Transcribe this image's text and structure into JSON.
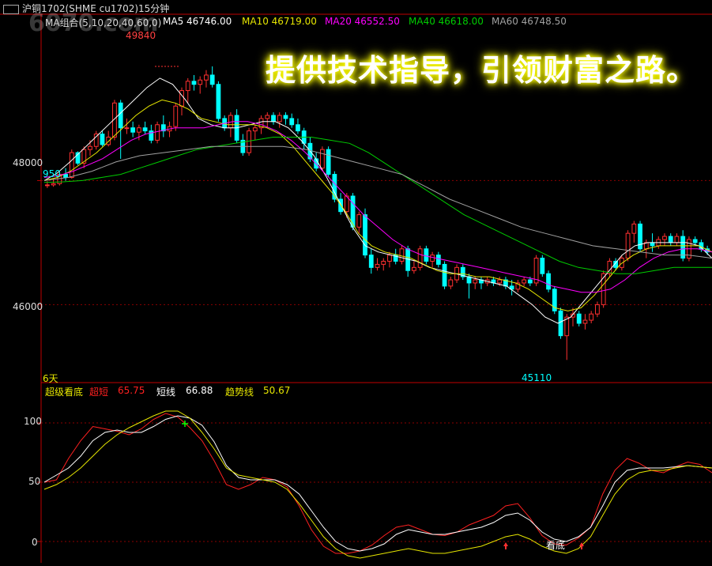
{
  "title": "沪铜1702(SHME  cu1702)15分钟",
  "watermark": "6070.com",
  "slogan": "提供技术指导，引领财富之路。",
  "ma_header": [
    {
      "label": "MA组合(5,10,20,40,60,0)",
      "color": "#d9d9d9"
    },
    {
      "label": "MA5 46746.00",
      "color": "#ffffff"
    },
    {
      "label": "MA10 46719.00",
      "color": "#e6e600"
    },
    {
      "label": "MA20 46552.50",
      "color": "#ff00ff"
    },
    {
      "label": "MA40 46618.00",
      "color": "#00cc00"
    },
    {
      "label": "MA60 46748.50",
      "color": "#a0a0a0"
    }
  ],
  "indicator_header": [
    {
      "label": "超级看底",
      "color": "#e6e600"
    },
    {
      "label": "超短",
      "color": "#ff2020"
    },
    {
      "label": "65.75",
      "color": "#ff2020"
    },
    {
      "label": "短线",
      "color": "#ffffff"
    },
    {
      "label": "66.88",
      "color": "#ffffff"
    },
    {
      "label": "趋势线",
      "color": "#e6e600"
    },
    {
      "label": "50.67",
      "color": "#e6e600"
    }
  ],
  "annotations": {
    "high": "49840",
    "low": "45110",
    "left_price": "950",
    "days": "6天",
    "bottom_signal": "看底"
  },
  "colors": {
    "up": "#ff3030",
    "down": "#00ffff",
    "grid": "#8b0000",
    "axis": "#c00000"
  },
  "chart_data": [
    {
      "type": "candlestick",
      "title": "沪铜1702 15分钟",
      "y_ticks": [
        46000,
        48000
      ],
      "ylim": [
        44770,
        50400
      ],
      "grid": true,
      "candles": [
        [
          47920,
          47990,
          47880,
          47930
        ],
        [
          47930,
          48030,
          47900,
          47950
        ],
        [
          47950,
          48150,
          47920,
          48100
        ],
        [
          48100,
          48200,
          48000,
          48050
        ],
        [
          48050,
          48500,
          48030,
          48450
        ],
        [
          48450,
          48470,
          48250,
          48280
        ],
        [
          48280,
          48550,
          48200,
          48500
        ],
        [
          48500,
          48650,
          48400,
          48550
        ],
        [
          48550,
          48800,
          48500,
          48750
        ],
        [
          48750,
          48800,
          48550,
          48580
        ],
        [
          48580,
          48800,
          48550,
          48700
        ],
        [
          48700,
          49300,
          48650,
          49250
        ],
        [
          49250,
          49300,
          48350,
          48850
        ],
        [
          48850,
          49000,
          48750,
          48850
        ],
        [
          48850,
          48950,
          48700,
          48780
        ],
        [
          48780,
          48900,
          48650,
          48850
        ],
        [
          48850,
          48950,
          48750,
          48800
        ],
        [
          48800,
          48900,
          48600,
          48650
        ],
        [
          48650,
          48950,
          48600,
          48900
        ],
        [
          48900,
          49050,
          48700,
          48800
        ],
        [
          48800,
          48950,
          48700,
          48870
        ],
        [
          48870,
          49250,
          48800,
          49200
        ],
        [
          49200,
          49500,
          49050,
          49450
        ],
        [
          49450,
          49650,
          49250,
          49600
        ],
        [
          49600,
          49700,
          49450,
          49550
        ],
        [
          49550,
          49680,
          49400,
          49620
        ],
        [
          49620,
          49780,
          49500,
          49700
        ],
        [
          49700,
          49840,
          49500,
          49550
        ],
        [
          49550,
          49600,
          48950,
          49000
        ],
        [
          49000,
          49050,
          48800,
          48850
        ],
        [
          48850,
          49100,
          48700,
          49050
        ],
        [
          49050,
          49150,
          48600,
          48650
        ],
        [
          48650,
          48750,
          48400,
          48450
        ],
        [
          48450,
          48850,
          48400,
          48800
        ],
        [
          48800,
          48900,
          48650,
          48850
        ],
        [
          48850,
          49050,
          48750,
          49000
        ],
        [
          49000,
          49100,
          48850,
          49050
        ],
        [
          49050,
          49100,
          48900,
          48950
        ],
        [
          48950,
          49100,
          48850,
          49050
        ],
        [
          49050,
          49100,
          48900,
          49000
        ],
        [
          49000,
          49080,
          48850,
          48900
        ],
        [
          48900,
          49000,
          48750,
          48800
        ],
        [
          48800,
          48850,
          48500,
          48600
        ],
        [
          48600,
          48700,
          48300,
          48350
        ],
        [
          48350,
          48450,
          48150,
          48200
        ],
        [
          48200,
          48550,
          48150,
          48500
        ],
        [
          48500,
          48550,
          48050,
          48100
        ],
        [
          48100,
          48150,
          47650,
          47700
        ],
        [
          47700,
          47800,
          47450,
          47500
        ],
        [
          47500,
          47800,
          47400,
          47750
        ],
        [
          47750,
          47800,
          47200,
          47250
        ],
        [
          47250,
          47500,
          47150,
          47450
        ],
        [
          47450,
          47550,
          46750,
          46800
        ],
        [
          46800,
          46900,
          46500,
          46600
        ],
        [
          46600,
          46750,
          46550,
          46650
        ],
        [
          46650,
          46750,
          46550,
          46700
        ],
        [
          46700,
          46850,
          46600,
          46800
        ],
        [
          46800,
          46900,
          46650,
          46700
        ],
        [
          46700,
          46950,
          46650,
          46900
        ],
        [
          46900,
          46950,
          46450,
          46550
        ],
        [
          46550,
          46700,
          46500,
          46600
        ],
        [
          46600,
          46950,
          46550,
          46900
        ],
        [
          46900,
          46950,
          46650,
          46700
        ],
        [
          46700,
          46850,
          46600,
          46800
        ],
        [
          46800,
          46850,
          46600,
          46650
        ],
        [
          46650,
          46700,
          46250,
          46300
        ],
        [
          46300,
          46450,
          46250,
          46400
        ],
        [
          46400,
          46650,
          46350,
          46600
        ],
        [
          46600,
          46650,
          46400,
          46450
        ],
        [
          46450,
          46500,
          46100,
          46350
        ],
        [
          46350,
          46450,
          46250,
          46400
        ],
        [
          46400,
          46450,
          46250,
          46350
        ],
        [
          46350,
          46450,
          46300,
          46400
        ],
        [
          46400,
          46450,
          46300,
          46350
        ],
        [
          46350,
          46450,
          46300,
          46400
        ],
        [
          46400,
          46450,
          46250,
          46300
        ],
        [
          46300,
          46400,
          46150,
          46250
        ],
        [
          46250,
          46400,
          46200,
          46350
        ],
        [
          46350,
          46450,
          46300,
          46400
        ],
        [
          46400,
          46450,
          46300,
          46350
        ],
        [
          46350,
          46800,
          46300,
          46750
        ],
        [
          46750,
          46800,
          46450,
          46500
        ],
        [
          46500,
          46550,
          46200,
          46250
        ],
        [
          46250,
          46300,
          45850,
          45900
        ],
        [
          45900,
          45950,
          45450,
          45500
        ],
        [
          45500,
          45850,
          45110,
          45800
        ],
        [
          45800,
          45950,
          45650,
          45850
        ],
        [
          45850,
          45900,
          45650,
          45700
        ],
        [
          45700,
          45850,
          45600,
          45750
        ],
        [
          45750,
          45900,
          45700,
          45850
        ],
        [
          45850,
          46050,
          45800,
          46000
        ],
        [
          46000,
          46550,
          45950,
          46500
        ],
        [
          46500,
          46750,
          46450,
          46700
        ],
        [
          46700,
          46750,
          46550,
          46600
        ],
        [
          46600,
          46800,
          46550,
          46750
        ],
        [
          46750,
          47200,
          46700,
          47150
        ],
        [
          47150,
          47350,
          47000,
          47300
        ],
        [
          47300,
          47350,
          46850,
          46900
        ],
        [
          46900,
          47050,
          46750,
          47000
        ],
        [
          47000,
          47150,
          46850,
          46950
        ],
        [
          46950,
          47100,
          46900,
          47050
        ],
        [
          47050,
          47150,
          46950,
          47100
        ],
        [
          47100,
          47150,
          46950,
          47000
        ],
        [
          47000,
          47150,
          46950,
          47100
        ],
        [
          47100,
          47200,
          46700,
          46750
        ],
        [
          46750,
          47100,
          46700,
          47050
        ],
        [
          47050,
          47100,
          46950,
          47000
        ],
        [
          47000,
          47050,
          46850,
          46900
        ],
        [
          46900,
          46950,
          46800,
          46850
        ]
      ],
      "ma_series": [
        {
          "name": "MA5",
          "color": "#ffffff",
          "values": [
            48000,
            48120,
            48300,
            48500,
            48700,
            48900,
            49100,
            49300,
            49500,
            49650,
            49550,
            49300,
            49000,
            48900,
            48850,
            48850,
            48900,
            48950,
            48950,
            48850,
            48650,
            48400,
            48050,
            47650,
            47250,
            46950,
            46850,
            46800,
            46750,
            46700,
            46600,
            46550,
            46500,
            46450,
            46400,
            46350,
            46300,
            46150,
            46000,
            45800,
            45700,
            45800,
            46050,
            46300,
            46550,
            46800,
            46950,
            47000,
            47000,
            47000,
            47000,
            46950,
            46750
          ]
        },
        {
          "name": "MA10",
          "color": "#e6e600",
          "values": [
            48000,
            48050,
            48150,
            48300,
            48450,
            48650,
            48850,
            49050,
            49200,
            49300,
            49250,
            49150,
            49000,
            48950,
            48900,
            48900,
            48900,
            48850,
            48750,
            48550,
            48300,
            48050,
            47800,
            47500,
            47150,
            46950,
            46850,
            46800,
            46750,
            46650,
            46550,
            46500,
            46500,
            46450,
            46450,
            46400,
            46350,
            46250,
            46100,
            45950,
            45900,
            45950,
            46150,
            46400,
            46650,
            46800,
            46900,
            46950,
            46950,
            46950,
            46950,
            46850
          ]
        },
        {
          "name": "MA20",
          "color": "#ff00ff",
          "values": [
            48050,
            48080,
            48150,
            48250,
            48350,
            48500,
            48650,
            48750,
            48800,
            48850,
            48850,
            48850,
            48900,
            48950,
            48950,
            48900,
            48800,
            48650,
            48450,
            48200,
            47950,
            47700,
            47450,
            47250,
            47050,
            46900,
            46800,
            46750,
            46700,
            46650,
            46600,
            46550,
            46500,
            46450,
            46400,
            46300,
            46250,
            46200,
            46200,
            46250,
            46400,
            46600,
            46750,
            46850,
            46900,
            46900,
            46850
          ]
        },
        {
          "name": "MA40",
          "color": "#00cc00",
          "values": [
            47970,
            47980,
            48000,
            48050,
            48100,
            48200,
            48300,
            48400,
            48500,
            48550,
            48600,
            48650,
            48700,
            48700,
            48700,
            48650,
            48600,
            48450,
            48250,
            48050,
            47850,
            47650,
            47450,
            47300,
            47150,
            47000,
            46850,
            46700,
            46600,
            46550,
            46500,
            46500,
            46550,
            46600,
            46600,
            46600
          ]
        },
        {
          "name": "MA60",
          "color": "#a0a0a0",
          "values": [
            48000,
            48050,
            48150,
            48300,
            48400,
            48450,
            48500,
            48550,
            48550,
            48550,
            48550,
            48500,
            48400,
            48300,
            48200,
            48100,
            47900,
            47700,
            47550,
            47400,
            47250,
            47150,
            47050,
            46950,
            46900,
            46850,
            46800,
            46800,
            46750
          ]
        }
      ]
    },
    {
      "type": "line",
      "title": "超级看底",
      "y_ticks": [
        0,
        50,
        100
      ],
      "ylim": [
        -18,
        120
      ],
      "grid": true,
      "series": [
        {
          "name": "超短",
          "color": "#ff2020",
          "values": [
            50,
            52,
            70,
            85,
            97,
            95,
            93,
            90,
            95,
            103,
            108,
            105,
            96,
            85,
            68,
            48,
            44,
            48,
            54,
            52,
            46,
            30,
            10,
            -4,
            -10,
            -10,
            -8,
            -3,
            5,
            12,
            14,
            10,
            6,
            5,
            8,
            14,
            18,
            22,
            30,
            32,
            20,
            5,
            -2,
            -3,
            3,
            12,
            40,
            60,
            70,
            66,
            60,
            58,
            63,
            67,
            65,
            58
          ]
        },
        {
          "name": "短线",
          "color": "#ffffff",
          "values": [
            50,
            56,
            62,
            72,
            85,
            92,
            94,
            92,
            92,
            97,
            103,
            106,
            104,
            98,
            84,
            64,
            54,
            52,
            52,
            52,
            48,
            40,
            26,
            12,
            0,
            -6,
            -8,
            -6,
            -2,
            6,
            10,
            8,
            6,
            6,
            8,
            10,
            12,
            16,
            22,
            24,
            18,
            8,
            2,
            0,
            4,
            12,
            30,
            50,
            60,
            62,
            62,
            62,
            63,
            64,
            63,
            62
          ]
        },
        {
          "name": "趋势线",
          "color": "#e6e600",
          "values": [
            44,
            48,
            54,
            62,
            72,
            82,
            90,
            96,
            101,
            106,
            110,
            110,
            104,
            92,
            78,
            62,
            56,
            54,
            52,
            50,
            44,
            32,
            18,
            4,
            -6,
            -12,
            -14,
            -12,
            -10,
            -8,
            -6,
            -8,
            -10,
            -10,
            -8,
            -6,
            -4,
            0,
            4,
            6,
            2,
            -4,
            -8,
            -10,
            -6,
            4,
            22,
            40,
            52,
            58,
            60,
            60,
            62,
            64,
            63,
            62
          ]
        }
      ]
    }
  ]
}
